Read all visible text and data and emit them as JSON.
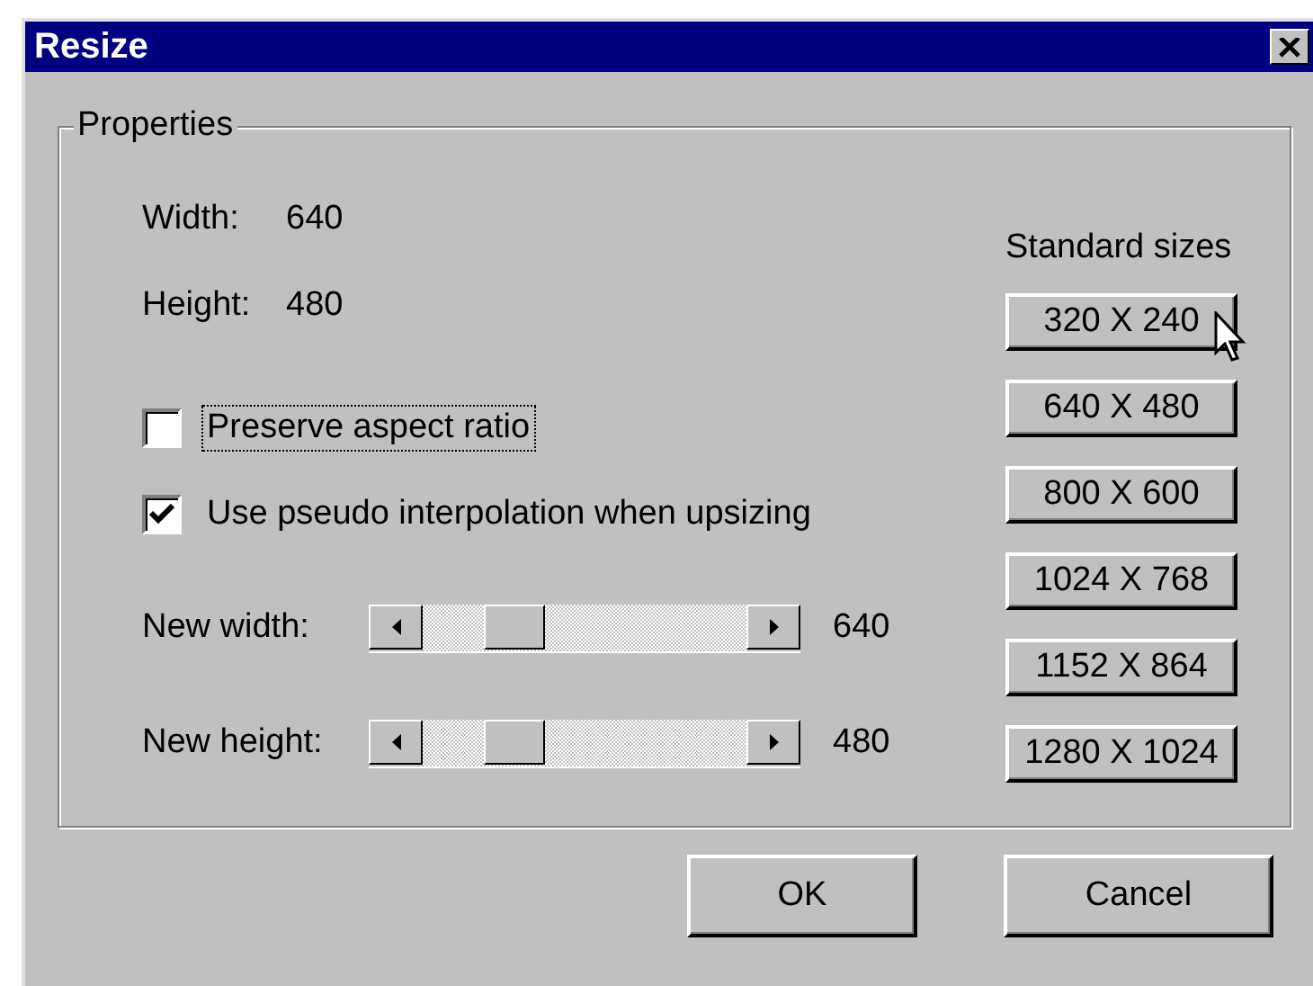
{
  "window": {
    "title": "Resize"
  },
  "properties": {
    "title": "Properties",
    "info": [
      {
        "label": "Width:",
        "value": "640"
      },
      {
        "label": "Height:",
        "value": "480"
      }
    ],
    "checkboxes": [
      {
        "label": "Preserve aspect ratio",
        "checked": false,
        "focused": true
      },
      {
        "label": "Use pseudo interpolation when upsizing",
        "checked": true,
        "focused": false
      }
    ],
    "sliders": [
      {
        "label": "New width:",
        "level": 0.23,
        "reading": "640"
      },
      {
        "label": "New height:",
        "level": 0.23,
        "reading": "480"
      }
    ],
    "standard_sizes": {
      "title": "Standard sizes",
      "buttons": [
        {
          "label": "320 X 240",
          "hovered": true
        },
        {
          "label": "640 X 480",
          "hovered": false
        },
        {
          "label": "800 X 600",
          "hovered": false
        },
        {
          "label": "1024 X 768",
          "hovered": false
        },
        {
          "label": "1152 X 864",
          "hovered": false
        },
        {
          "label": "1280 X 1024",
          "hovered": false
        }
      ]
    }
  },
  "buttons": [
    {
      "label": "OK"
    },
    {
      "label": "Cancel"
    }
  ]
}
